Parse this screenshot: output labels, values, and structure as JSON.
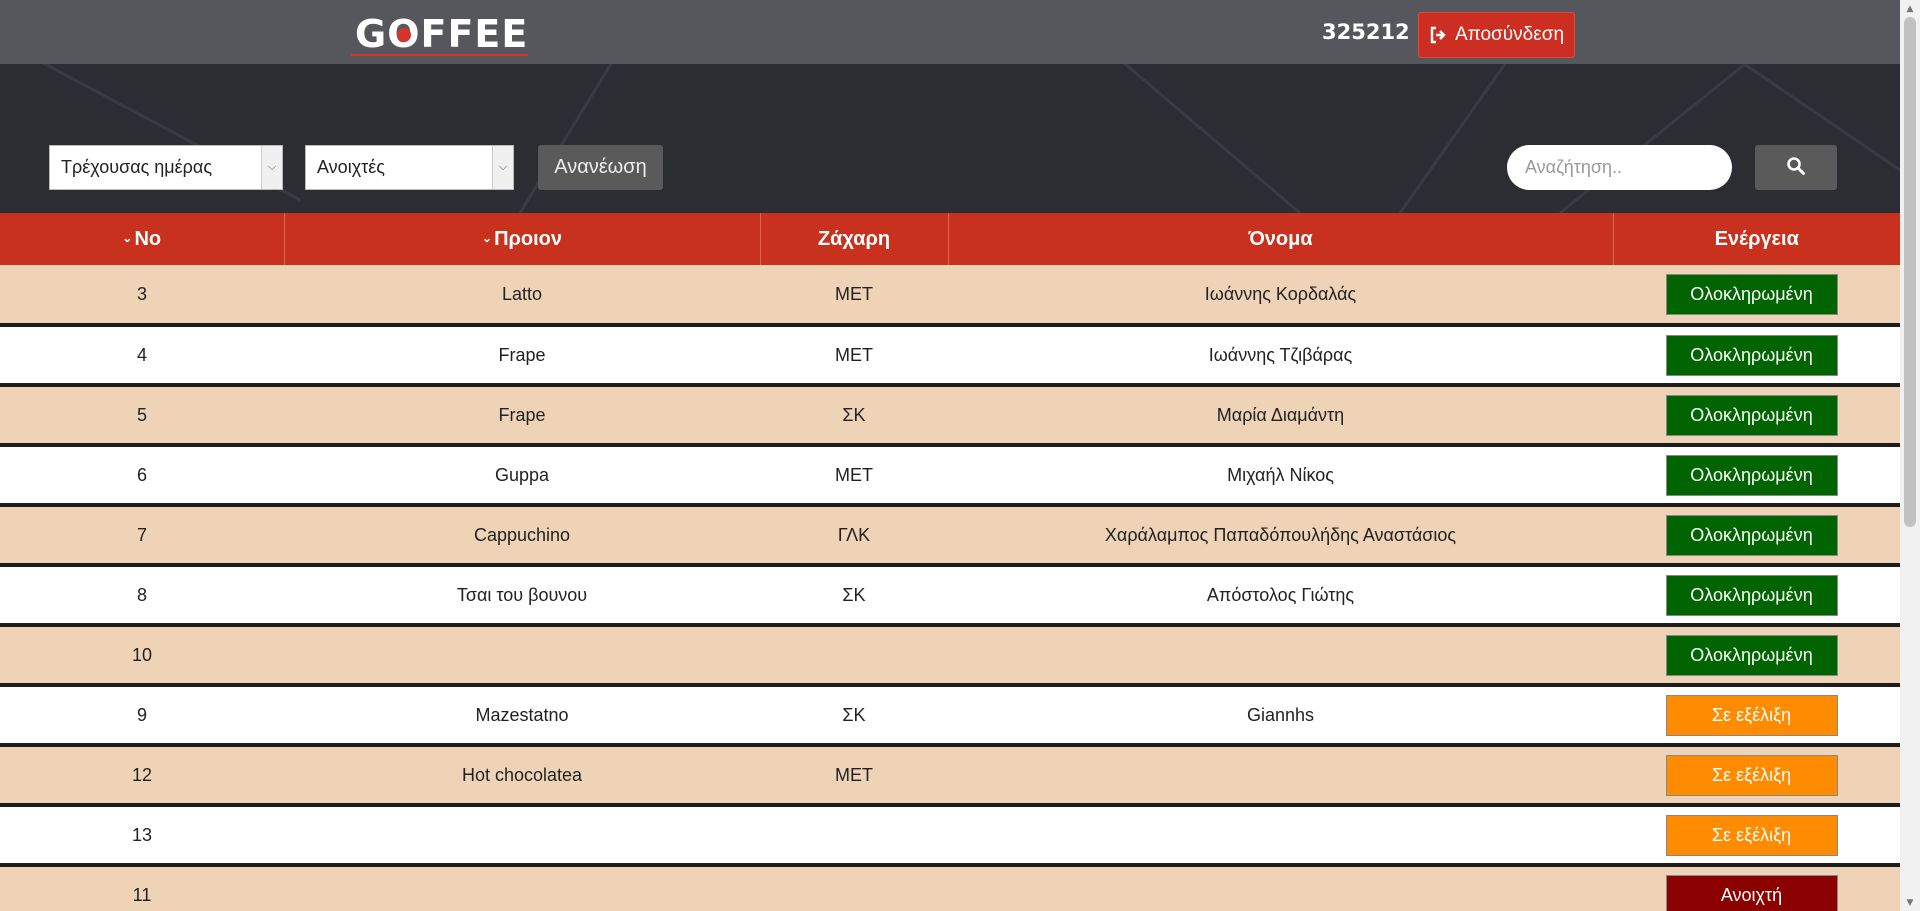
{
  "header": {
    "logo_text_pre": "G",
    "logo_text_o": "O",
    "logo_text_post": "FFEE",
    "user_id": "325212",
    "logout_label": "Αποσύνδεση"
  },
  "filters": {
    "period_select": "Τρέχουσας ημέρας",
    "status_select": "Ανοιχτές",
    "refresh_label": "Ανανέωση",
    "search_placeholder": "Αναζήτηση.."
  },
  "table": {
    "headers": {
      "no": "No",
      "product": "Προιον",
      "sugar": "Ζάχαρη",
      "name": "Όνομα",
      "action": "Ενέργεια"
    },
    "rows": [
      {
        "no": "3",
        "product": "Latto",
        "sugar": "ΜΕΤ",
        "name": "Ιωάννης Κορδαλάς",
        "action": "Ολοκληρωμένη",
        "action_color": "#006400"
      },
      {
        "no": "4",
        "product": "Frape",
        "sugar": "ΜΕΤ",
        "name": "Ιωάννης Τζιβάρας",
        "action": "Ολοκληρωμένη",
        "action_color": "#006400"
      },
      {
        "no": "5",
        "product": "Frape",
        "sugar": "ΣΚ",
        "name": "Μαρία Διαμάντη",
        "action": "Ολοκληρωμένη",
        "action_color": "#006400"
      },
      {
        "no": "6",
        "product": "Guppa",
        "sugar": "ΜΕΤ",
        "name": "Μιχαήλ Νίκος",
        "action": "Ολοκληρωμένη",
        "action_color": "#006400"
      },
      {
        "no": "7",
        "product": "Cappuchino",
        "sugar": "ΓΛΚ",
        "name": "Χαράλαμπος Παπαδόπουλήδης Αναστάσιος",
        "action": "Ολοκληρωμένη",
        "action_color": "#006400"
      },
      {
        "no": "8",
        "product": "Τσαι του βουνου",
        "sugar": "ΣΚ",
        "name": "Απόστολος Γιώτης",
        "action": "Ολοκληρωμένη",
        "action_color": "#006400"
      },
      {
        "no": "10",
        "product": "",
        "sugar": "",
        "name": "",
        "action": "Ολοκληρωμένη",
        "action_color": "#006400"
      },
      {
        "no": "9",
        "product": "Mazestatno",
        "sugar": "ΣΚ",
        "name": "Giannhs",
        "action": "Σε εξέλιξη",
        "action_color": "#ff8c00"
      },
      {
        "no": "12",
        "product": "Hot chocolatea",
        "sugar": "ΜΕΤ",
        "name": "",
        "action": "Σε εξέλιξη",
        "action_color": "#ff8c00"
      },
      {
        "no": "13",
        "product": "",
        "sugar": "",
        "name": "",
        "action": "Σε εξέλιξη",
        "action_color": "#ff8c00"
      },
      {
        "no": "11",
        "product": "",
        "sugar": "",
        "name": "",
        "action": "Ανοιχτή",
        "action_color": "#8b0000"
      }
    ]
  },
  "colors": {
    "header_bar": "#56575c",
    "table_header": "#c8311d",
    "row_odd": "#efd3b7",
    "row_even": "#ffffff",
    "logout": "#cc2e22"
  },
  "icons": {
    "logout": "sign-out-icon",
    "search": "search-icon",
    "sort": "chevron-down-icon",
    "dropdown": "caret-down-icon"
  }
}
